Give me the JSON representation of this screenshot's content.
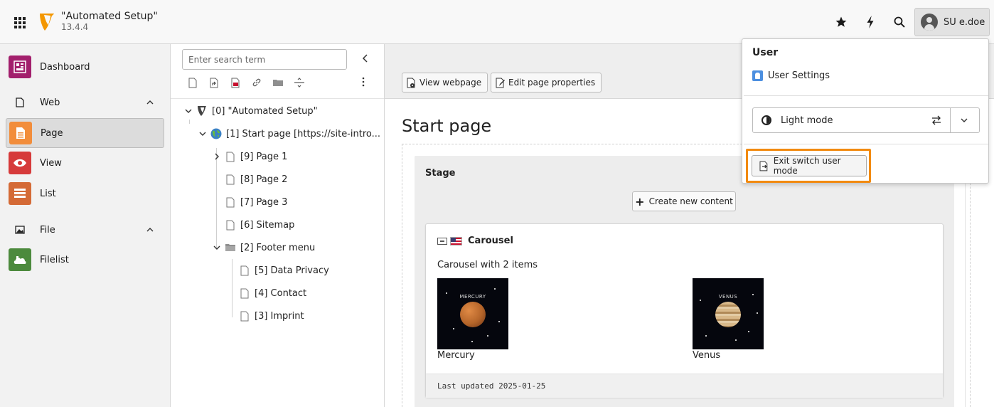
{
  "topbar": {
    "site_name": "\"Automated Setup\"",
    "version": "13.4.4",
    "user_label": "SU e.doe",
    "icons": [
      "app-grid-icon",
      "typo3-logo",
      "bookmark-star-icon",
      "flash-icon",
      "search-icon",
      "user-avatar-icon"
    ]
  },
  "modules": {
    "items": [
      {
        "label": "Dashboard",
        "icon": "dashboard-icon",
        "color": "#a21f6c"
      },
      {
        "label": "Page",
        "icon": "page-icon",
        "color": "#f28d3b",
        "active": true
      },
      {
        "label": "View",
        "icon": "eye-icon",
        "color": "#d63a3a"
      },
      {
        "label": "List",
        "icon": "list-icon",
        "color": "#d46a36"
      },
      {
        "label": "Filelist",
        "icon": "filelist-icon",
        "color": "#4c8a3d"
      }
    ],
    "groups": [
      {
        "label": "Web",
        "icon": "web-icon"
      },
      {
        "label": "File",
        "icon": "file-image-icon"
      }
    ]
  },
  "tree": {
    "search_placeholder": "Enter search term",
    "toolbar": [
      "new-page-icon",
      "new-shortcut-icon",
      "new-mount-icon",
      "link-icon",
      "folder-icon",
      "separator-icon"
    ],
    "nodes": [
      {
        "label": "[0] \"Automated Setup\""
      },
      {
        "label": "[1] Start page [https://site-intro..."
      },
      {
        "label": "[9] Page 1"
      },
      {
        "label": "[8] Page 2"
      },
      {
        "label": "[7] Page 3"
      },
      {
        "label": "[6] Sitemap"
      },
      {
        "label": "[2] Footer menu"
      },
      {
        "label": "[5] Data Privacy"
      },
      {
        "label": "[4] Contact"
      },
      {
        "label": "[3] Imprint"
      }
    ]
  },
  "main": {
    "view_webpage": "View webpage",
    "edit_page_properties": "Edit page properties",
    "page_title": "Start page",
    "stage_title": "Stage",
    "create_new_content": "Create new content",
    "content_element": {
      "title": "Carousel",
      "description": "Carousel with 2 items",
      "items": [
        {
          "caption": "Mercury",
          "image_label": "MERCURY",
          "color": "#b5652a"
        },
        {
          "caption": "Venus",
          "image_label": "VENUS",
          "color": "#c9a46e"
        }
      ],
      "footer": "Last updated 2025-01-25"
    }
  },
  "user_menu": {
    "title": "User",
    "user_settings": "User Settings",
    "mode_label": "Light mode",
    "exit_switch": "Exit switch user mode",
    "highlight_color": "#f28a10"
  }
}
